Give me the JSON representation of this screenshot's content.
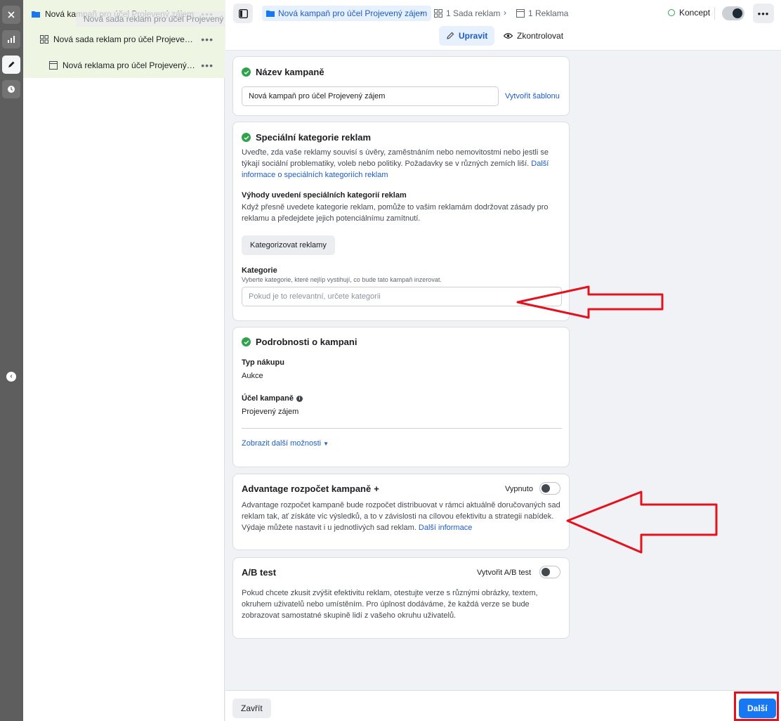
{
  "tree": {
    "campaign": "Nová kampaň pro účel Projevený zájem",
    "ad_set": "Nová sada reklam pro účel Projevený z...",
    "ad": "Nová reklama pro účel Projevený záj...",
    "drag_ghost": "Nová sada reklam pro účel Projevený zájem",
    "more": "•••"
  },
  "header": {
    "crumbs": {
      "campaign": "Nová kampaň pro účel Projevený zájem",
      "ad_set": "1 Sada reklam",
      "ad": "1 Reklama"
    },
    "status": "Koncept",
    "tabs": {
      "edit": "Upravit",
      "review": "Zkontrolovat"
    }
  },
  "name_card": {
    "title": "Název kampaně",
    "input_value": "Nová kampaň pro účel Projevený zájem",
    "template_link": "Vytvořit šablonu"
  },
  "special_card": {
    "title": "Speciální kategorie reklam",
    "text": "Uveďte, zda vaše reklamy souvisí s úvěry, zaměstnáním nebo nemovitostmi nebo jestli se týkají sociální problematiky, voleb nebo politiky. Požadavky se v různých zemích liší.",
    "link": "Další informace o speciálních kategoriích reklam",
    "benefits_title": "Výhody uvedení speciálních kategorií reklam",
    "benefits_text": "Když přesně uvedete kategorie reklam, pomůže to vašim reklamám dodržovat zásady pro reklamu a předejdete jejich potenciálnímu zamítnutí.",
    "button": "Kategorizovat reklamy",
    "category_label": "Kategorie",
    "category_help": "Vyberte kategorie, které nejlíp vystihují, co bude tato kampaň inzerovat.",
    "category_placeholder": "Pokud je to relevantní, určete kategorii"
  },
  "details_card": {
    "title": "Podrobnosti o kampani",
    "purchase_label": "Typ nákupu",
    "purchase_value": "Aukce",
    "objective_label": "Účel kampaně",
    "objective_value": "Projevený zájem",
    "more_link": "Zobrazit další možnosti"
  },
  "advantage_card": {
    "title": "Advantage rozpočet kampaně",
    "plus": "+",
    "toggle_label": "Vypnuto",
    "text": "Advantage rozpočet kampaně bude rozpočet distribuovat v rámci aktuálně doručovaných sad reklam tak, ať získáte víc výsledků, a to v závislosti na cílovou efektivitu a strategii nabídek. Výdaje můžete nastavit i u jednotlivých sad reklam.",
    "link": "Další informace"
  },
  "ab_card": {
    "title": "A/B test",
    "toggle_label": "Vytvořit A/B test",
    "text": "Pokud chcete zkusit zvýšit efektivitu reklam, otestujte verze s různými obrázky, textem, okruhem uživatelů nebo umístěním. Pro úplnost dodáváme, že každá verze se bude zobrazovat samostatné skupině lidí z vašeho okruhu uživatelů."
  },
  "footer": {
    "close": "Zavřít",
    "next": "Další"
  },
  "colors": {
    "accent": "#1877f2",
    "success": "#31a24c",
    "annotation": "#e3121e"
  }
}
